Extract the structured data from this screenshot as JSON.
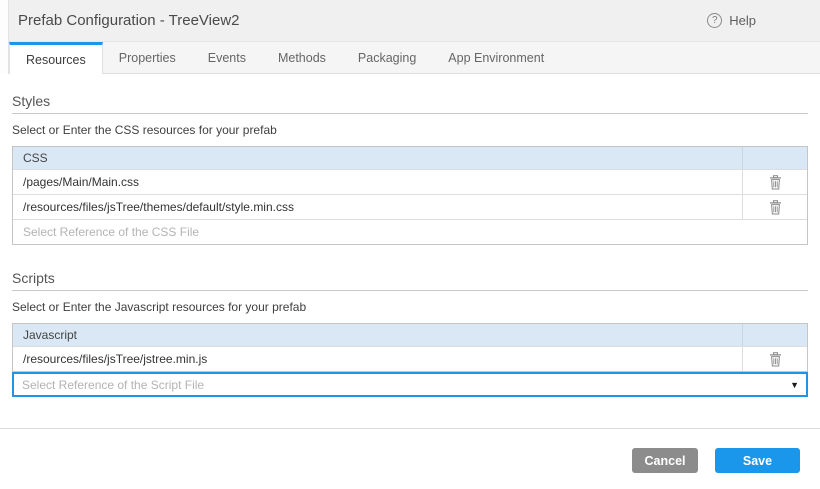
{
  "app": {
    "title": "Prefab Configuration - TreeView2",
    "help_label": "Help",
    "help_icon_glyph": "?"
  },
  "tabs": [
    {
      "label": "Resources",
      "active": true
    },
    {
      "label": "Properties",
      "active": false
    },
    {
      "label": "Events",
      "active": false
    },
    {
      "label": "Methods",
      "active": false
    },
    {
      "label": "Packaging",
      "active": false
    },
    {
      "label": "App Environment",
      "active": false
    }
  ],
  "styles_section": {
    "heading": "Styles",
    "subtitle": "Select or Enter the CSS resources for your prefab",
    "table": {
      "header": "CSS",
      "rows": [
        "/pages/Main/Main.css",
        "/resources/files/jsTree/themes/default/style.min.css"
      ],
      "input_placeholder": "Select Reference of the CSS File"
    }
  },
  "scripts_section": {
    "heading": "Scripts",
    "subtitle": "Select or Enter the Javascript resources for your prefab",
    "table": {
      "header": "Javascript",
      "rows": [
        "/resources/files/jsTree/jstree.min.js"
      ],
      "input_placeholder": "Select Reference of the Script File"
    }
  },
  "footer": {
    "cancel_label": "Cancel",
    "save_label": "Save"
  },
  "icons": {
    "trash": "trash-icon",
    "help": "help-circle-icon",
    "dropdown": "▼"
  },
  "colors": {
    "accent_blue": "#1a96ea",
    "table_header_bg": "#d9e8f4",
    "titlebar_bg": "#f0f0f0",
    "cancel_gray": "#8c8c8c",
    "focused_border": "#1e95ec"
  }
}
